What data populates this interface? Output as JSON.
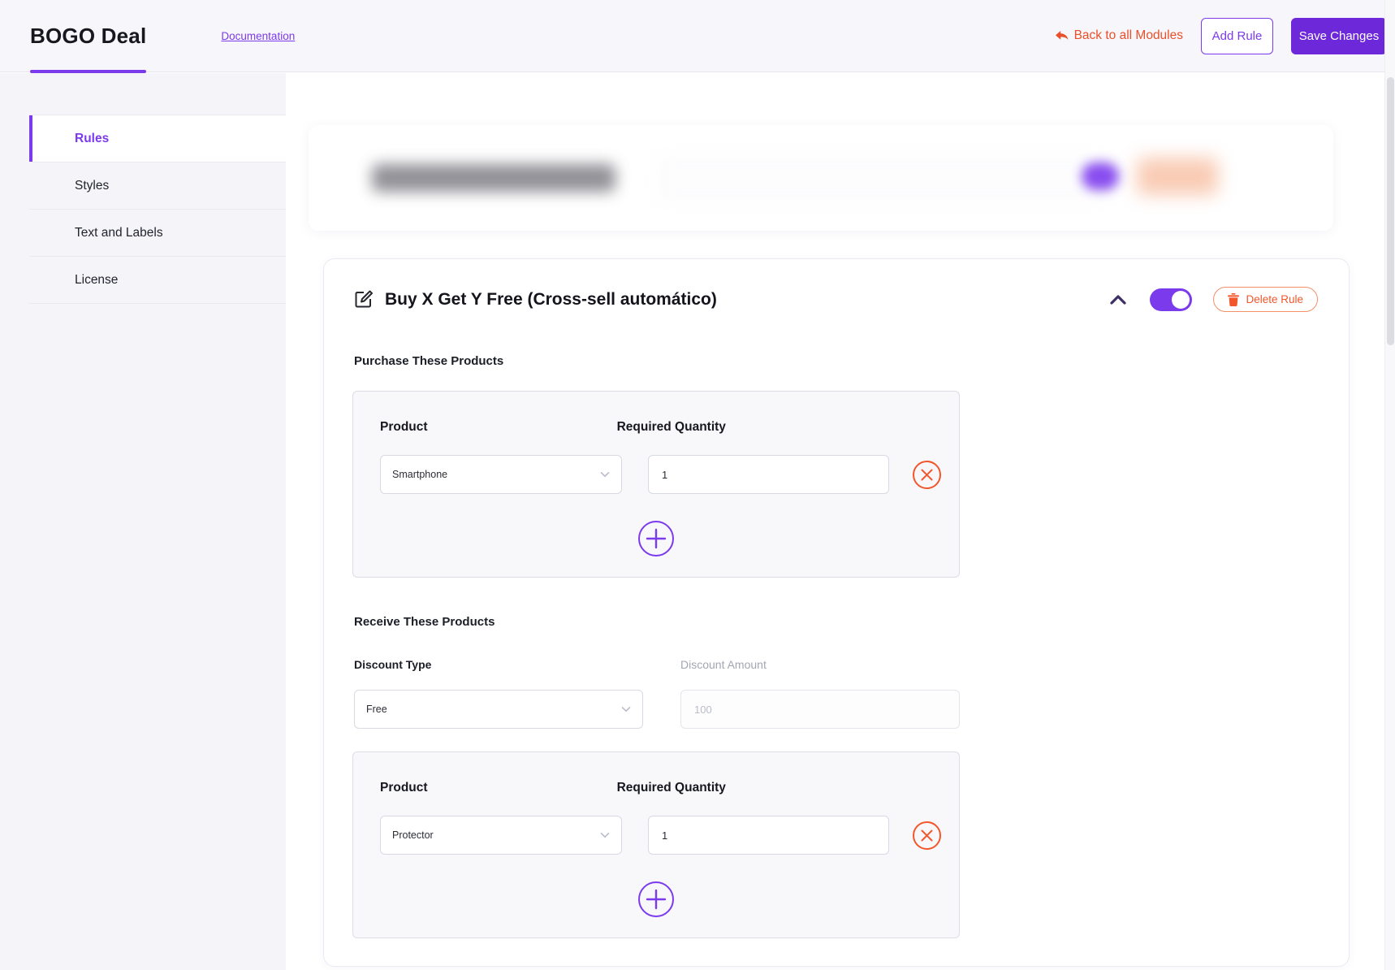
{
  "app": {
    "title": "BOGO Deal",
    "doc_link": "Documentation"
  },
  "topbar": {
    "back_link": "Back to all Modules",
    "add_rule": "Add Rule",
    "save": "Save Changes"
  },
  "sidebar": {
    "active": "Rules",
    "items": [
      {
        "label": "Rules"
      },
      {
        "label": "Styles"
      },
      {
        "label": "Text and Labels"
      },
      {
        "label": "License"
      }
    ]
  },
  "rule_card": {
    "title": "Buy X Get Y Free (Cross-sell automático)",
    "enabled": true,
    "delete_label": "Delete Rule",
    "purchase": {
      "heading": "Purchase These Products",
      "product_label": "Product",
      "quantity_label": "Required Quantity",
      "product": "Smartphone",
      "quantity": "1"
    },
    "receive": {
      "heading": "Receive These Products",
      "discount_type_label": "Discount Type",
      "discount_type": "Free",
      "discount_amount_label": "Discount Amount",
      "discount_amount_placeholder": "100",
      "product_label": "Product",
      "quantity_label": "Required Quantity",
      "product": "Protector",
      "quantity": "1"
    }
  },
  "icons": {
    "back": "back-arrow-icon",
    "edit": "edit-pencil-icon",
    "collapse": "chevron-up-icon",
    "trash": "trash-icon",
    "remove": "circle-x-icon",
    "add": "circle-plus-icon",
    "select": "chevron-down-icon"
  },
  "colors": {
    "primary": "#7c3aed",
    "primary_dark": "#6d28d9",
    "orange": "#f2572b",
    "panel_bg": "#f8f8fb",
    "sidebar_bg": "#f5f4f8"
  }
}
